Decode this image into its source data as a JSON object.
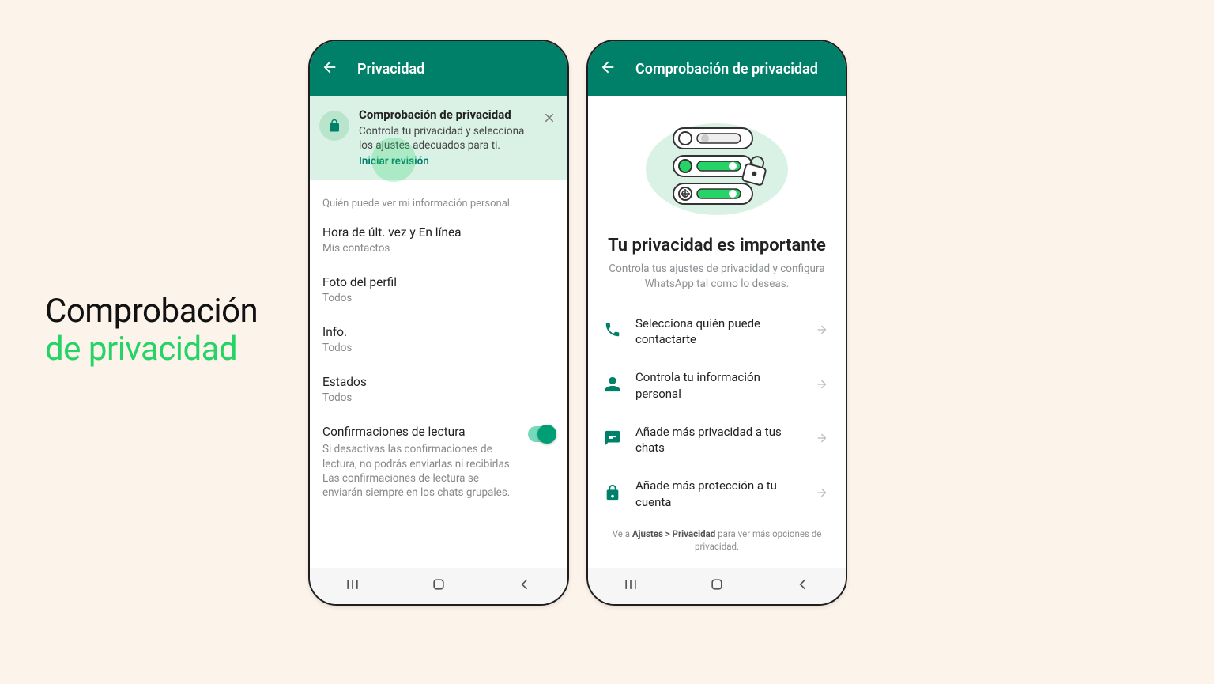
{
  "promo": {
    "line1": "Comprobación",
    "line2": "de privacidad"
  },
  "left": {
    "appbar_title": "Privacidad",
    "banner": {
      "title": "Comprobación de privacidad",
      "desc": "Controla tu privacidad y selecciona los ajustes adecuados para ti.",
      "link": "Iniciar revisión"
    },
    "section_label": "Quién puede ver mi información personal",
    "rows": {
      "lastseen": {
        "title": "Hora de últ. vez y En línea",
        "sub": "Mis contactos"
      },
      "photo": {
        "title": "Foto del perfil",
        "sub": "Todos"
      },
      "info": {
        "title": "Info.",
        "sub": "Todos"
      },
      "status": {
        "title": "Estados",
        "sub": "Todos"
      },
      "receipts": {
        "title": "Confirmaciones de lectura",
        "desc": "Si desactivas las confirmaciones de lectura, no podrás enviarlas ni recibirlas. Las confirmaciones de lectura se enviarán siempre en los chats grupales."
      }
    }
  },
  "right": {
    "appbar_title": "Comprobación de privacidad",
    "headline": "Tu privacidad es importante",
    "sub": "Controla tus ajustes de privacidad y configura WhatsApp tal como lo deseas.",
    "actions": {
      "contact": "Selecciona quién puede contactarte",
      "personal": "Controla tu información personal",
      "chats": "Añade más privacidad a tus chats",
      "account": "Añade más protección a tu cuenta"
    },
    "footnote_pre": "Ve a ",
    "footnote_bold": "Ajustes > Privacidad",
    "footnote_post": " para ver más opciones de privacidad."
  }
}
